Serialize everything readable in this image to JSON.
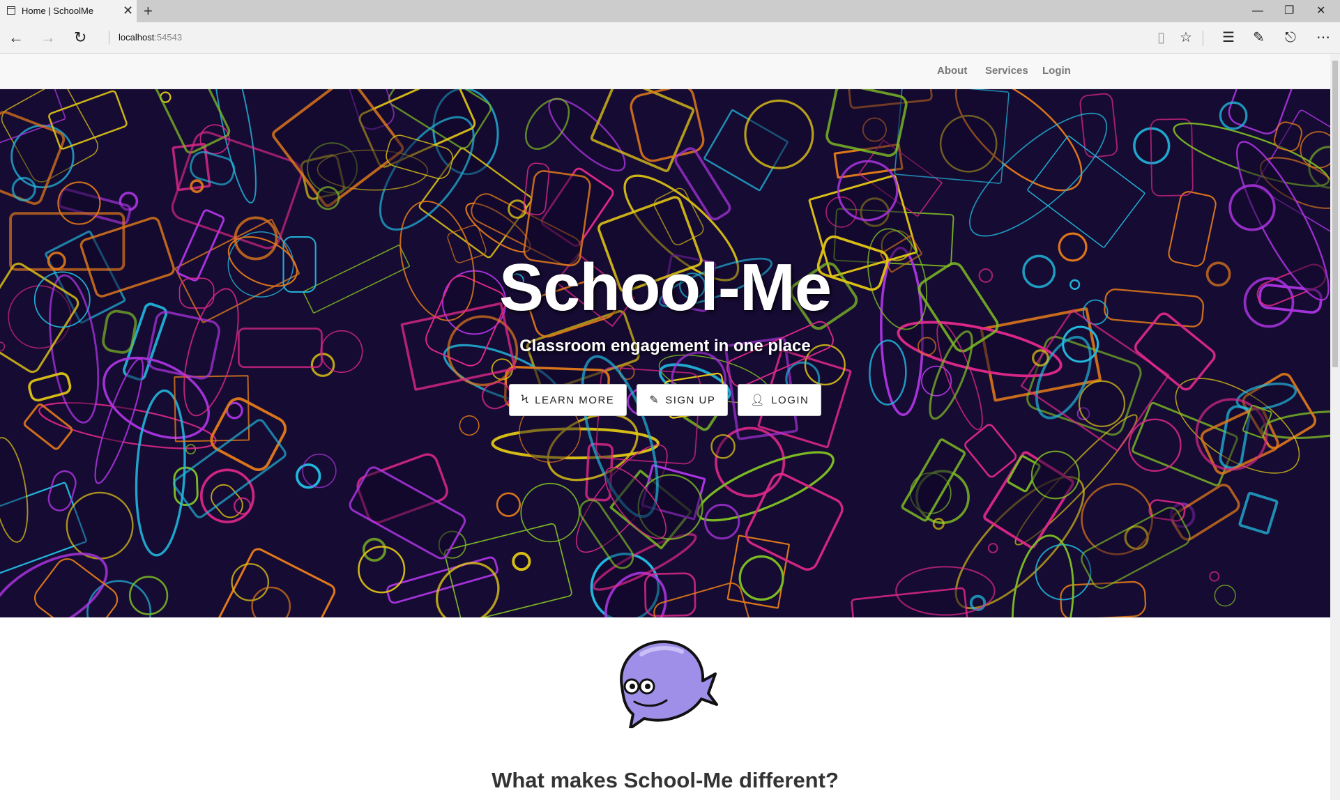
{
  "browser": {
    "tab_title": "Home | SchoolMe",
    "address_host": "localhost",
    "address_port": ":54543"
  },
  "nav": {
    "about": "About",
    "services": "Services",
    "login": "Login"
  },
  "hero": {
    "title": "School-Me",
    "subtitle": "Classroom engagement in one place",
    "buttons": {
      "learn_more": "Learn More",
      "sign_up": "Sign Up",
      "login": "Login"
    }
  },
  "content": {
    "heading": "What makes School-Me different?"
  },
  "colors": {
    "hero_bg": "#1a0d3a",
    "neon_pink": "#ff2f9e",
    "neon_yellow": "#ffe119",
    "neon_cyan": "#27d4ff",
    "neon_green": "#8fd62a",
    "neon_orange": "#ff8a1f",
    "whale": "#9f8fe8"
  }
}
